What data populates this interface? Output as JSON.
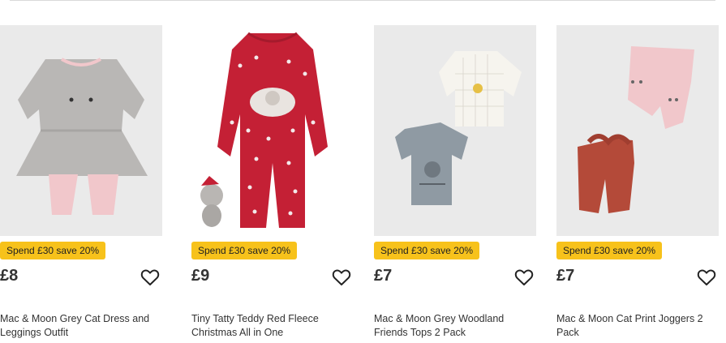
{
  "products": [
    {
      "image_alt": "Tiny Tatty Teddy Red Fleece Christmas All in One",
      "promo": "Spend £30 save 20%",
      "price": "£9",
      "title": "Tiny Tatty Teddy Red Fleece Christmas All in One",
      "wishlist_icon": "heart-outline-icon"
    },
    {
      "image_alt": "Mac & Moon Grey Woodland Friends Tops 2 Pack",
      "promo": "Spend £30 save 20%",
      "price": "£7",
      "title": "Mac & Moon Grey Woodland Friends Tops 2 Pack",
      "wishlist_icon": "heart-outline-icon"
    },
    {
      "image_alt": "Mac & Moon Cat Print Joggers 2 Pack",
      "promo": "Spend £30 save 20%",
      "price": "£7",
      "title": "Mac & Moon Cat Print Joggers 2 Pack",
      "wishlist_icon": "heart-outline-icon"
    },
    {
      "image_alt": "Mac & Moon Grey Cat Dress and Leggings Outfit",
      "promo": "Spend £30 save 20%",
      "price": "£8",
      "title": "Mac & Moon Grey Cat Dress and Leggings Outfit",
      "wishlist_icon": "heart-outline-icon"
    }
  ],
  "colors": {
    "promo_badge": "#f7c21b",
    "image_background": "#eaeaea",
    "text": "#333333"
  }
}
